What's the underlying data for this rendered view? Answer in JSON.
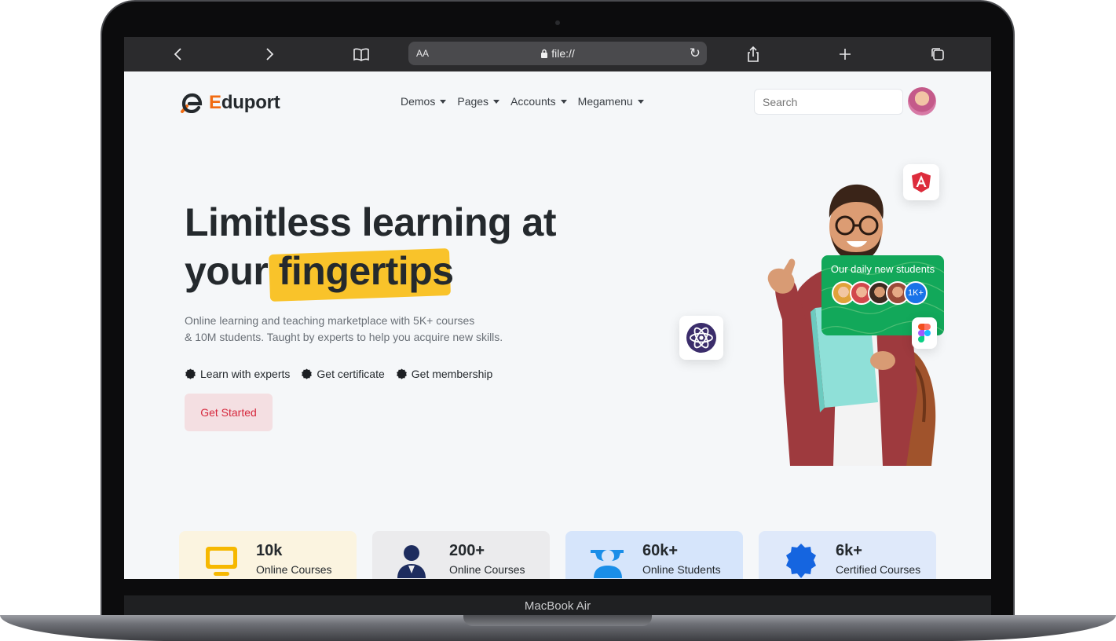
{
  "device": {
    "label": "MacBook Air"
  },
  "browser": {
    "text_size_label": "AA",
    "url": "file://",
    "icons": [
      "back-icon",
      "forward-icon",
      "bookmarks-icon",
      "lock-icon",
      "reload-icon",
      "share-icon",
      "new-tab-icon",
      "tabs-icon"
    ]
  },
  "navbar": {
    "logo_letter": "E",
    "logo_rest": "duport",
    "items": [
      {
        "label": "Demos"
      },
      {
        "label": "Pages"
      },
      {
        "label": "Accounts"
      },
      {
        "label": "Megamenu"
      }
    ],
    "search_placeholder": "Search"
  },
  "hero": {
    "title_line1": "Limitless learning at",
    "title_line2_prefix": "your",
    "title_highlight": "fingertips",
    "subtitle_line1": "Online learning and teaching marketplace with 5K+ courses",
    "subtitle_line2": "& 10M students. Taught by experts to help you acquire new skills.",
    "features": [
      {
        "label": "Learn with experts"
      },
      {
        "label": "Get certificate"
      },
      {
        "label": "Get membership"
      }
    ],
    "cta_label": "Get Started",
    "students_card": {
      "title": "Our daily new students",
      "count": "1K+"
    }
  },
  "stats": [
    {
      "value": "10k",
      "label": "Online Courses",
      "icon": "monitor-icon",
      "bg": "#fbf4e0"
    },
    {
      "value": "200+",
      "label": "Online Courses",
      "icon": "tutor-icon",
      "bg": "#ebebed"
    },
    {
      "value": "60k+",
      "label": "Online Students",
      "icon": "graduate-icon",
      "bg": "#d6e5fb"
    },
    {
      "value": "6k+",
      "label": "Certified Courses",
      "icon": "badge-icon",
      "bg": "#dfe9fa"
    }
  ],
  "colors": {
    "accent_orange": "#f16b12",
    "highlight_yellow": "#f9c32a",
    "cta_text": "#d6293e",
    "cta_bg": "#f4dfe2",
    "brand_blue": "#1a73e8",
    "card_green": "#12a85a"
  }
}
